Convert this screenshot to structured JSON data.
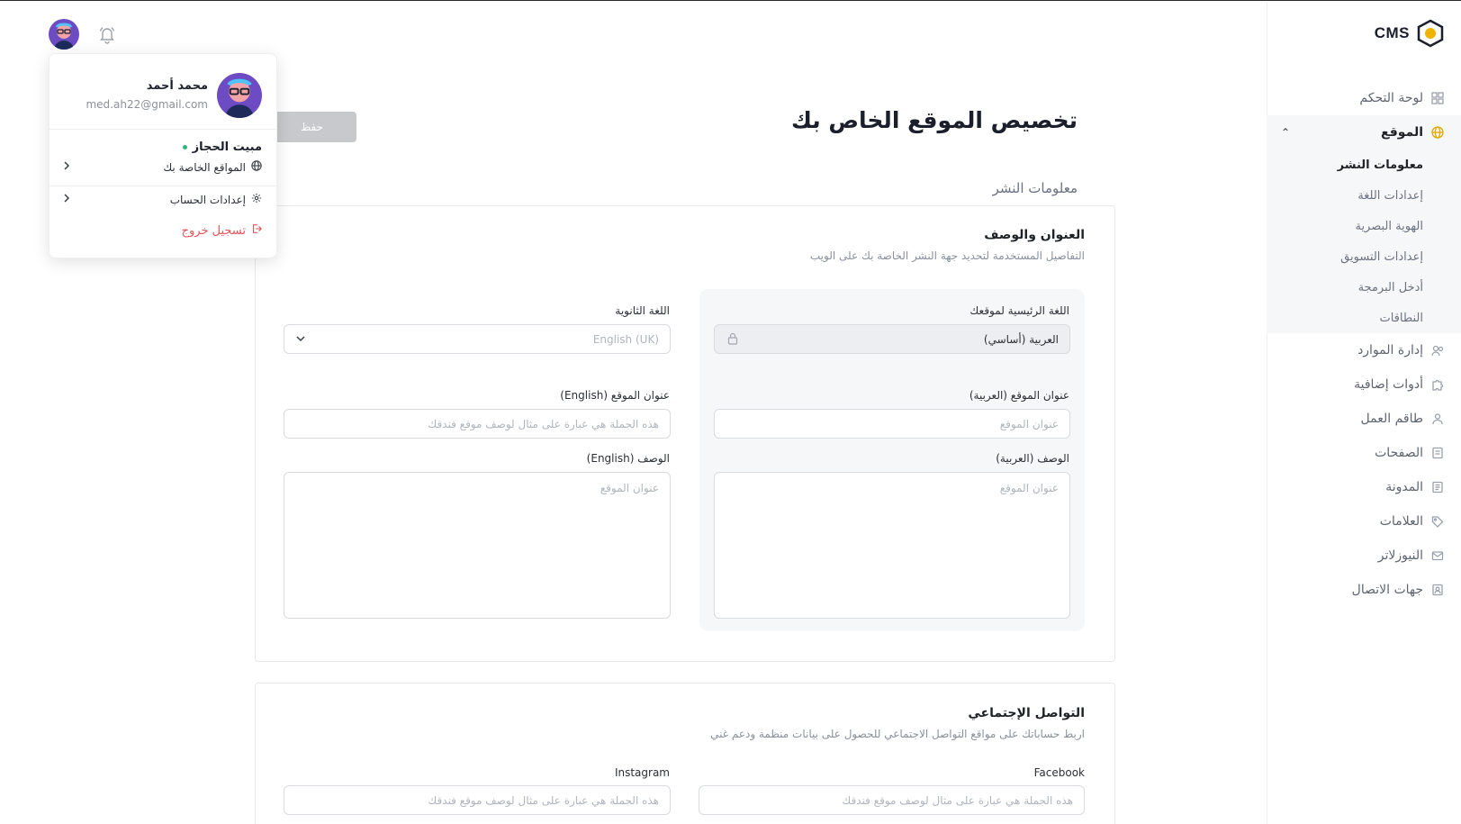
{
  "brand": {
    "name": "CMS",
    "accent": "#e0a800"
  },
  "sidebar": {
    "items": [
      {
        "label": "لوحة التحكم",
        "icon": "grid-icon"
      },
      {
        "label": "الموقع",
        "icon": "globe-icon",
        "expanded": true,
        "children": [
          "معلومات النشر",
          "إعدادات اللغة",
          "الهوية البصرية",
          "إعدادات التسويق",
          "أدخل البرمجة",
          "النطاقات"
        ]
      },
      {
        "label": "إدارة الموارد",
        "icon": "users-icon"
      },
      {
        "label": "أدوات إضافية",
        "icon": "puzzle-icon"
      },
      {
        "label": "طاقم العمل",
        "icon": "team-icon"
      },
      {
        "label": "الصفحات",
        "icon": "pages-icon"
      },
      {
        "label": "المدونة",
        "icon": "blog-icon"
      },
      {
        "label": "العلامات",
        "icon": "tag-icon"
      },
      {
        "label": "النيوزلاتر",
        "icon": "newsletter-icon"
      },
      {
        "label": "جهات الاتصال",
        "icon": "contacts-icon"
      }
    ]
  },
  "page": {
    "title": "تخصيص الموقع الخاص بك",
    "save_label": "حفظ",
    "section_label": "معلومات النشر"
  },
  "card_title_desc": {
    "title": "العنوان والوصف",
    "subtitle": "التفاصيل المستخدمة لتحديد جهة النشر الخاصة بك على الويب",
    "primary_lang_label": "اللغة الرئيسية لموقعك",
    "primary_lang_value": "العربية (أساسي)",
    "secondary_lang_label": "اللغة الثانوية",
    "secondary_lang_placeholder": "English (UK)",
    "site_title_ar_label": "عنوان الموقع (العربية)",
    "site_title_ar_placeholder": "عنوان الموقع",
    "site_title_en_label": "عنوان الموقع (English)",
    "site_title_en_placeholder": "هذه الجملة هي عبارة على مثال لوصف موقع فندقك",
    "desc_ar_label": "الوصف (العربية)",
    "desc_ar_placeholder": "عنوان الموقع",
    "desc_en_label": "الوصف (English)",
    "desc_en_placeholder": "عنوان الموقع"
  },
  "card_social": {
    "title": "التواصل الإجتماعي",
    "subtitle": "اربط حساباتك على مواقع التواصل الاجتماعي للحصول على بيانات منظمة ودعم غني",
    "facebook_label": "Facebook",
    "facebook_placeholder": "هذه الجملة هي عبارة على مثال لوصف موقع فندقك",
    "instagram_label": "Instagram",
    "instagram_placeholder": "هذه الجملة هي عبارة على مثال لوصف موقع فندقك"
  },
  "user_menu": {
    "name": "محمد أحمد",
    "email": "med.ah22@gmail.com",
    "site_name": "مبيت الحجاز",
    "my_sites": "المواقع الخاصة بك",
    "account_settings": "إعدادات الحساب",
    "logout": "تسجيل خروج"
  }
}
